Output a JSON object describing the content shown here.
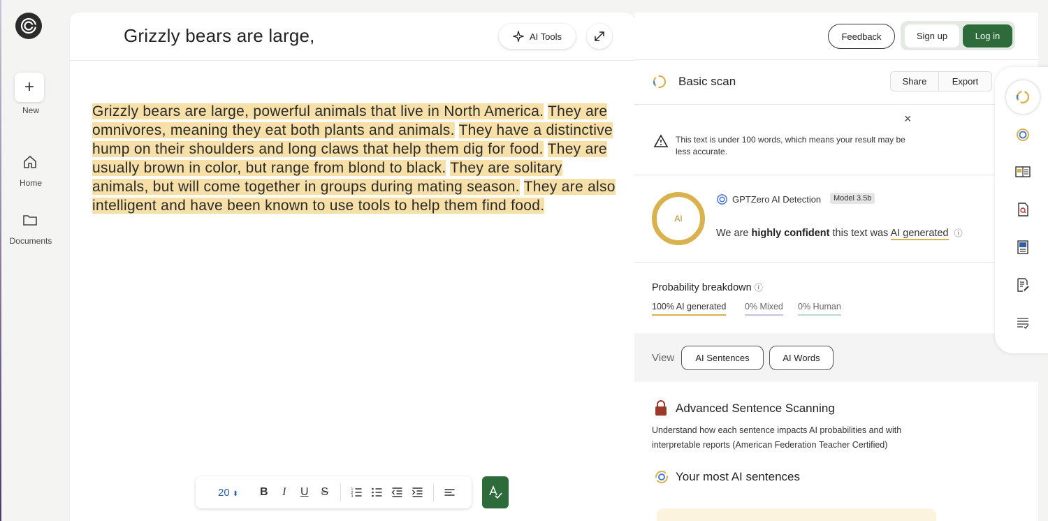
{
  "rail": {
    "new_label": "New",
    "home_label": "Home",
    "documents_label": "Documents"
  },
  "editor": {
    "title": "Grizzly bears are large,",
    "ai_tools_label": "AI Tools",
    "sentences": [
      "Grizzly bears are large, powerful animals that live in North America.",
      "They are omnivores, meaning they eat both plants and animals.",
      "They have a distinctive hump on their shoulders and long claws that help them dig for food.",
      "They are usually brown in color, but range from blond to black.",
      "They are solitary animals, but will come together in groups during mating season.",
      "They are also intelligent and have been known to use tools to help them find food."
    ],
    "highlight_color": "#f6e0a8",
    "toolbar": {
      "font_size": "20",
      "bold": "B",
      "italic": "I",
      "underline": "U",
      "strike": "S"
    }
  },
  "header": {
    "feedback_label": "Feedback",
    "signup_label": "Sign up",
    "login_label": "Log in",
    "brand_green": "#2e6b3a"
  },
  "scan": {
    "title": "Basic scan",
    "share_label": "Share",
    "export_label": "Export",
    "warning_text": "This text is under 100 words, which means your result may be less accurate.",
    "close_symbol": "×",
    "ring_label": "AI",
    "detector_label": "GPTZero AI Detection",
    "model_badge": "Model 3.5b",
    "confidence_prefix": "We are ",
    "confidence_strong": "highly confident",
    "confidence_mid": " this text was ",
    "confidence_result": "AI generated",
    "ai_color": "#d9b24e"
  },
  "probability": {
    "title": "Probability breakdown",
    "ai": "100% AI generated",
    "mixed": "0% Mixed",
    "human": "0% Human"
  },
  "view": {
    "label": "View",
    "sentences_btn": "AI Sentences",
    "words_btn": "AI Words"
  },
  "advanced": {
    "title": "Advanced Sentence Scanning",
    "description": "Understand how each sentence impacts AI probabilities and with interpretable reports (American Federation Teacher Certified)",
    "most_title": "Your most AI sentences"
  }
}
